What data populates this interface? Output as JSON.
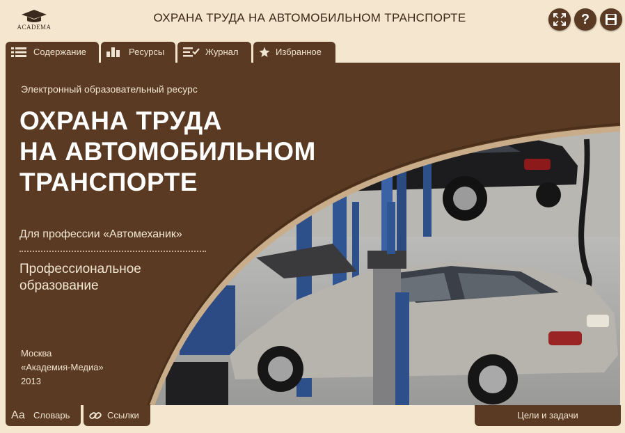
{
  "header": {
    "logo_text": "ACADEMA",
    "title": "ОХРАНА ТРУДА НА АВТОМОБИЛЬНОМ ТРАНСПОРТЕ",
    "buttons": {
      "fullscreen": "fullscreen-icon",
      "help": "?",
      "save": "save-icon"
    }
  },
  "tabs": [
    {
      "label": "Содержание",
      "icon": "list-icon"
    },
    {
      "label": "Ресурсы",
      "icon": "bars-icon"
    },
    {
      "label": "Журнал",
      "icon": "checklist-icon"
    },
    {
      "label": "Избранное",
      "icon": "star-icon"
    }
  ],
  "main": {
    "subtitle": "Электронный образовательный ресурс",
    "title_lines": [
      "ОХРАНА ТРУДА",
      "НА АВТОМОБИЛЬНОМ",
      "ТРАНСПОРТЕ"
    ],
    "profession": "Для профессии «Автомеханик»",
    "education_lines": [
      "Профессиональное",
      "образование"
    ],
    "publisher_lines": [
      "Москва",
      "«Академия-Медиа»",
      "2013"
    ]
  },
  "bottom": {
    "glossary_icon": "Аа",
    "glossary_label": "Словарь",
    "links_label": "Ссылки",
    "goals_label": "Цели и задачи"
  },
  "colors": {
    "background": "#f4e6cf",
    "panel": "#5a3a22",
    "accent_line": "#c9ad8a"
  }
}
